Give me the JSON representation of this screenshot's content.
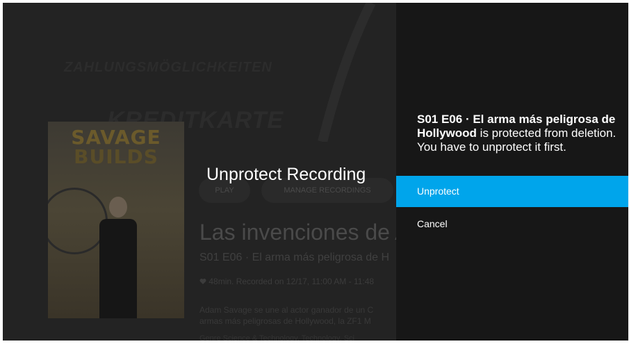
{
  "background": {
    "watermark_1": "ZAHLUNGSMÖGLICHKEITEN",
    "watermark_2": "KREDITKARTE",
    "poster": {
      "title_line_1": "SAVAGE",
      "title_line_2": "BUILDS"
    },
    "buttons": {
      "play": "PLAY",
      "manage": "MANAGE RECORDINGS"
    },
    "show_title": "Las invenciones de A",
    "episode_line": "S01 E06 · El arma más peligrosa de H",
    "duration": "48min.",
    "recorded_label": "Recorded on",
    "recorded_value": "12/17, 11:00 AM - 11:48",
    "description_line_1": "Adam Savage se une al actor ganador de un C",
    "description_line_2": "armas más peligrosas de Hollywood, la ZF1 M",
    "genre_label": "Genre",
    "genre_value": "Science & Technology, Technology, Sci"
  },
  "dialog": {
    "title": "Unprotect Recording",
    "message_bold": "S01 E06 · El arma más peligrosa de Hollywood",
    "message_rest": " is protected from deletion. You have to unprotect it first.",
    "options": {
      "primary": "Unprotect",
      "secondary": "Cancel"
    }
  },
  "colors": {
    "highlight": "#00a5eb",
    "panel": "#171717",
    "background": "#1e1e1e"
  },
  "icons": {
    "duration": "heart-icon"
  }
}
